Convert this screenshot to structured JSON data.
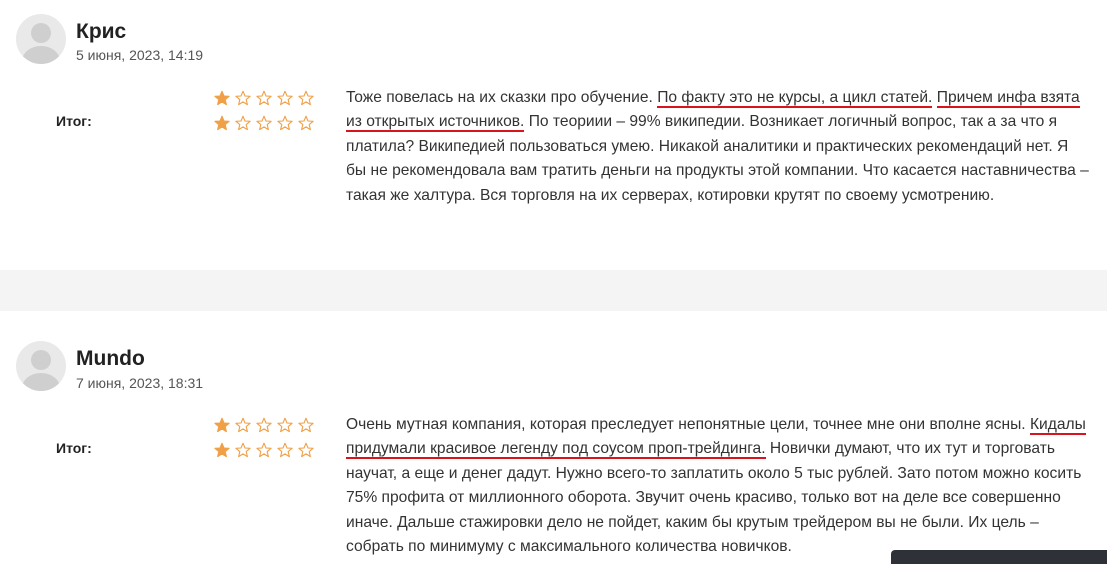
{
  "reviews": [
    {
      "author": "Крис",
      "date": "5 июня, 2023, 14:19",
      "total_label": "Итог:",
      "rating_rows": [
        1,
        1
      ],
      "text_before": "Тоже повелась на их сказки про обучение. ",
      "highlight_1": "По факту это не курсы, а цикл статей.",
      "text_mid": " ",
      "highlight_2": "Причем инфа взята из открытых источников.",
      "text_after": " По теориии – 99% википедии. Возникает логичный вопрос, так а за что я платила? Википедией пользоваться умею. Никакой аналитики и практических рекомендаций нет. Я бы не рекомендовала вам тратить деньги на продукты этой компании. Что касается наставничества – такая же халтура. Вся торговля на их серверах, котировки крутят по своему усмотрению."
    },
    {
      "author": "Mundo",
      "date": "7 июня, 2023, 18:31",
      "total_label": "Итог:",
      "rating_rows": [
        1,
        1
      ],
      "text_before": "Очень мутная компания, которая преследует непонятные цели, точнее мне они вполне ясны. ",
      "highlight_1": "Кидалы придумали красивое легенду под соусом проп-трейдинга.",
      "text_after": " Новички думают, что их тут и торговать научат, а еще и денег дадут. Нужно всего-то заплатить около 5 тыс рублей. Зато потом можно косить 75% профита от миллионного оборота. Звучит очень красиво, только вот на деле все совершенно иначе. Дальше стажировки дело не пойдет, каким бы крутым трейдером вы не были. Их цель – собрать по минимуму с максимального количества новичков."
    }
  ],
  "stars_max": 5,
  "colors": {
    "star": "#f0a046",
    "highlight": "#d9141d"
  }
}
